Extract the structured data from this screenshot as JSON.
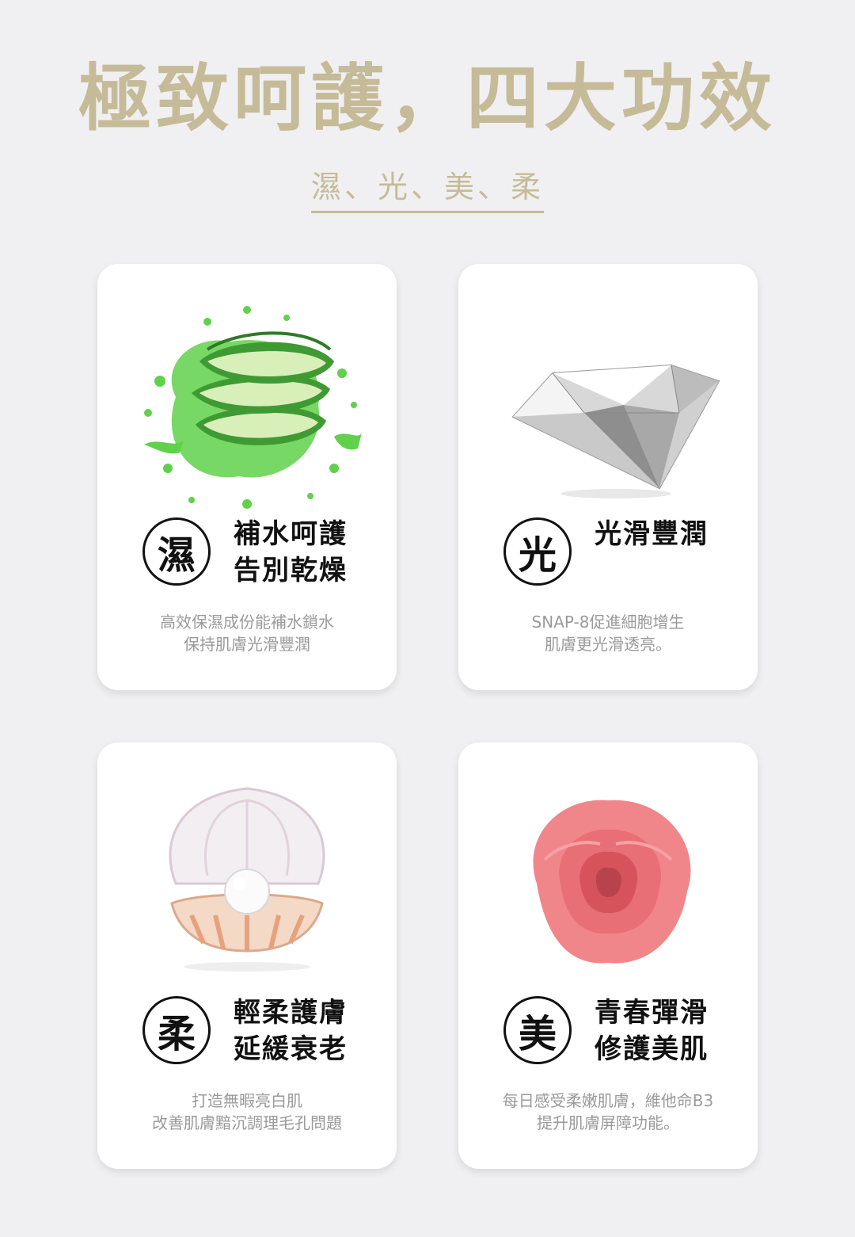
{
  "header": {
    "title": "極致呵護，四大功效",
    "subtitle": "濕、光、美、柔"
  },
  "cards": [
    {
      "image": "aloe-vera-splash",
      "badge": "濕",
      "headline": [
        "補水呵護",
        "告別乾燥"
      ],
      "desc": [
        "高效保濕成份能補水鎖水",
        "保持肌膚光滑豐潤"
      ]
    },
    {
      "image": "diamond",
      "badge": "光",
      "headline": [
        "光滑豐潤"
      ],
      "desc": [
        "SNAP-8促進細胞增生",
        "肌膚更光滑透亮。"
      ]
    },
    {
      "image": "pearl-shell",
      "badge": "柔",
      "headline": [
        "輕柔護膚",
        "延緩衰老"
      ],
      "desc": [
        "打造無暇亮白肌",
        "改善肌膚黯沉調理毛孔問題"
      ]
    },
    {
      "image": "pink-rose",
      "badge": "美",
      "headline": [
        "青春彈滑",
        "修護美肌"
      ],
      "desc": [
        "每日感受柔嫩肌膚，維他命B3",
        "提升肌膚屏障功能。"
      ]
    }
  ],
  "colors": {
    "accent": "#c6bb98",
    "background": "#f0f0f2",
    "card": "#ffffff",
    "text": "#111111",
    "muted": "#9a9a9a"
  }
}
